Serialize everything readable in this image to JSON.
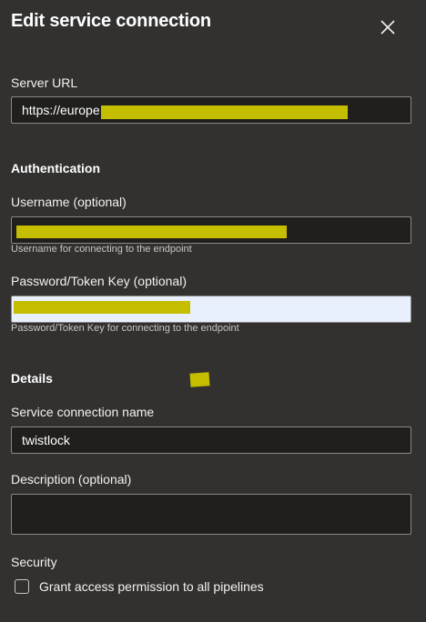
{
  "dialog": {
    "title": "Edit service connection",
    "close_icon": "close-icon"
  },
  "server_url": {
    "label": "Server URL",
    "value": "https://europe"
  },
  "authentication": {
    "heading": "Authentication",
    "username": {
      "label": "Username (optional)",
      "value": "",
      "helper": "Username for connecting to the endpoint"
    },
    "password": {
      "label": "Password/Token Key (optional)",
      "value": "",
      "helper": "Password/Token Key for connecting to the endpoint"
    }
  },
  "details": {
    "heading": "Details",
    "connection_name": {
      "label": "Service connection name",
      "value": "twistlock"
    },
    "description": {
      "label": "Description (optional)",
      "value": ""
    }
  },
  "security": {
    "heading": "Security",
    "grant_access": {
      "label": "Grant access permission to all pipelines",
      "checked": false
    }
  },
  "colors": {
    "background": "#323130",
    "input_background": "#201f1e",
    "autofill_background": "#e8f0fe",
    "redaction": "#c4bd00"
  }
}
